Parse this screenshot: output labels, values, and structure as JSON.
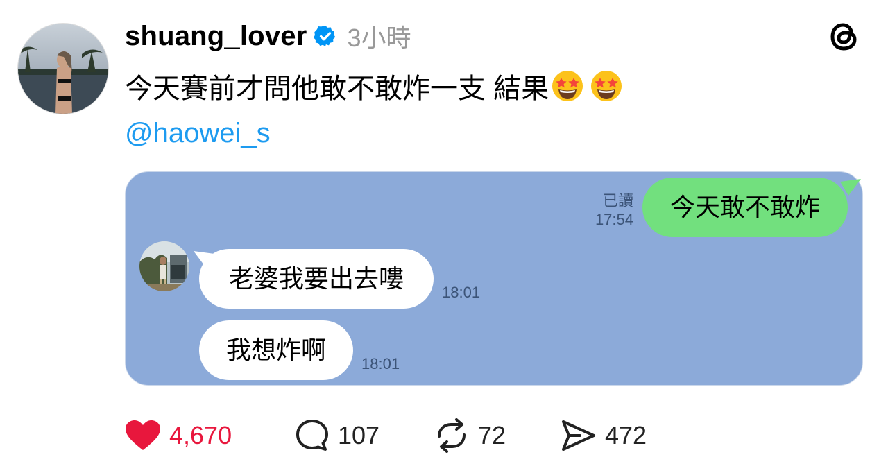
{
  "post": {
    "username": "shuang_lover",
    "time": "3小時",
    "text": "今天賽前才問他敢不敢炸一支 結果",
    "emojis": [
      "star-struck",
      "star-struck"
    ],
    "mention": "@haowei_s"
  },
  "chat": {
    "sent": {
      "text": "今天敢不敢炸",
      "read_label": "已讀",
      "time": "17:54"
    },
    "received": [
      {
        "text": "老婆我要出去嘍",
        "time": "18:01"
      },
      {
        "text": "我想炸啊",
        "time": "18:01"
      }
    ]
  },
  "actions": {
    "likes": "4,670",
    "replies": "107",
    "reposts": "72",
    "shares": "472"
  },
  "colors": {
    "like": "#e8173d",
    "mention": "#1d9bf0",
    "verified": "#0095f6",
    "chat_bg": "#8caad9",
    "sent_bubble": "#72e07e",
    "time_gray": "#999999"
  },
  "icons": [
    "verified-badge-icon",
    "threads-logo-icon",
    "heart-icon",
    "comment-icon",
    "repost-icon",
    "share-icon"
  ]
}
